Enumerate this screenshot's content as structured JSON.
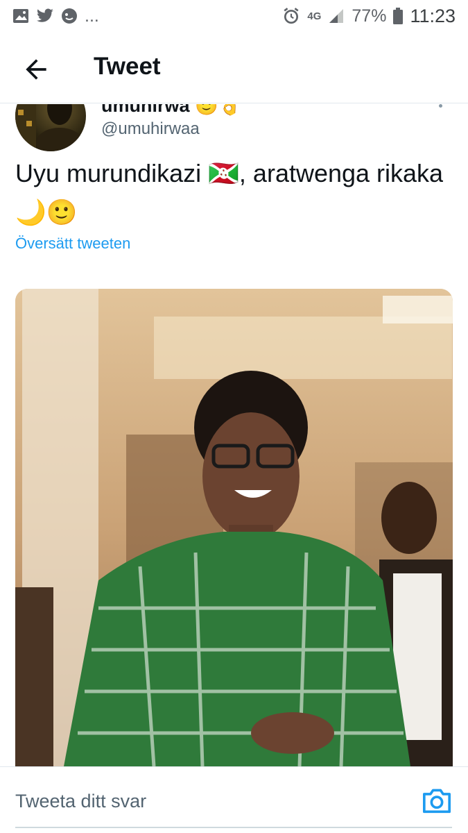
{
  "status_bar": {
    "network": "4G",
    "battery": "77%",
    "time": "11:23",
    "overflow": "...",
    "icons": [
      "gallery-icon",
      "twitter-bird-icon",
      "notification-face-icon",
      "alarm-icon",
      "signal-icon",
      "battery-icon"
    ]
  },
  "header": {
    "title": "Tweet"
  },
  "tweet": {
    "author_name": "umuhirwa 🙂👌",
    "handle": "@umuhirwaa",
    "text": "Uyu murundikazi 🇧🇮, aratwenga rikaka 🌙🙂",
    "translate_label": "Översätt tweeten"
  },
  "reply": {
    "placeholder": "Tweeta ditt svar"
  },
  "colors": {
    "accent": "#1d9bf0",
    "text": "#0f1419",
    "secondary": "#536471",
    "divider": "#e1e8ed"
  }
}
